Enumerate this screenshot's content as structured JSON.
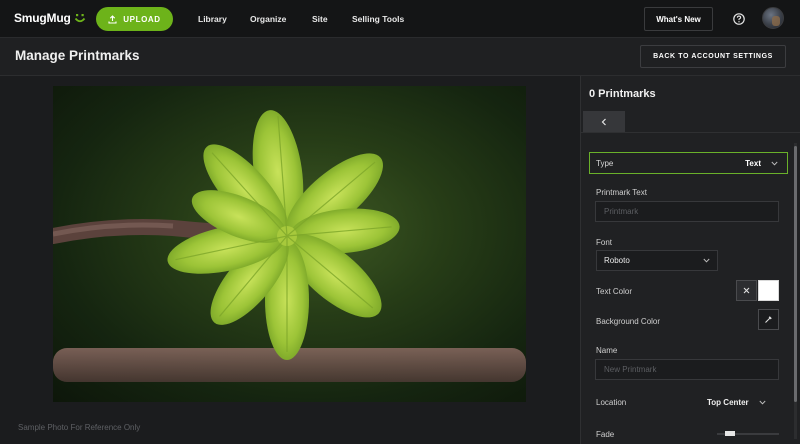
{
  "nav": {
    "logo": "SmugMug",
    "upload_label": "UPLOAD",
    "links": [
      "Library",
      "Organize",
      "Site",
      "Selling Tools"
    ],
    "whats_new": "What's New"
  },
  "header": {
    "title": "Manage Printmarks",
    "back_button": "BACK TO ACCOUNT SETTINGS"
  },
  "preview": {
    "note": "Sample Photo For Reference Only"
  },
  "panel": {
    "title": "0 Printmarks",
    "type_label": "Type",
    "type_value": "Text",
    "printmark_text_label": "Printmark Text",
    "printmark_text_placeholder": "Printmark",
    "font_label": "Font",
    "font_value": "Roboto",
    "text_color_label": "Text Color",
    "background_color_label": "Background Color",
    "name_label": "Name",
    "name_placeholder": "New Printmark",
    "location_label": "Location",
    "location_value": "Top Center",
    "fade_label": "Fade",
    "fade_level": 0.15
  },
  "colors": {
    "accent": "#6db31a",
    "text_color_value": "#ffffff"
  }
}
